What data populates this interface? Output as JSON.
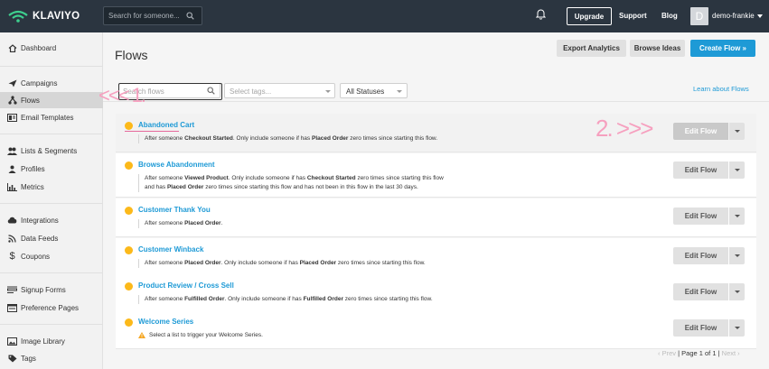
{
  "brand": {
    "name": "KLAVIYO",
    "accent": "#1e9ad6",
    "dot_color": "#fcb91a",
    "annotation_color": "#f6a0bf"
  },
  "topbar": {
    "search_placeholder": "Search for someone...",
    "upgrade": "Upgrade",
    "support": "Support",
    "blog": "Blog",
    "avatar_letter": "D",
    "user": "demo-frankie"
  },
  "sidebar": {
    "items": [
      {
        "label": "Dashboard",
        "icon": "home-icon"
      },
      {
        "label": "Campaigns",
        "icon": "paper-plane-icon"
      },
      {
        "label": "Flows",
        "icon": "flows-icon",
        "active": true
      },
      {
        "label": "Email Templates",
        "icon": "template-icon"
      },
      {
        "label": "Lists & Segments",
        "icon": "users-icon"
      },
      {
        "label": "Profiles",
        "icon": "person-icon"
      },
      {
        "label": "Metrics",
        "icon": "bar-chart-icon"
      },
      {
        "label": "Integrations",
        "icon": "cloud-icon"
      },
      {
        "label": "Data Feeds",
        "icon": "rss-icon"
      },
      {
        "label": "Coupons",
        "icon": "dollar-icon"
      },
      {
        "label": "Signup Forms",
        "icon": "form-icon"
      },
      {
        "label": "Preference Pages",
        "icon": "page-icon"
      },
      {
        "label": "Image Library",
        "icon": "image-icon"
      },
      {
        "label": "Tags",
        "icon": "tag-icon"
      }
    ]
  },
  "main": {
    "title": "Flows",
    "export": "Export Analytics",
    "browse": "Browse Ideas",
    "create": "Create Flow »",
    "learn": "Learn about Flows",
    "filter_search_placeholder": "Search flows",
    "filter_tags_placeholder": "Select tags...",
    "filter_status": "All Statuses",
    "edit_label": "Edit Flow",
    "flows": [
      {
        "name": "Abandoned Cart",
        "desc_html": "After someone <b>Checkout Started</b>. Only include someone if has <b>Placed Order</b> zero times since starting this flow."
      },
      {
        "name": "Browse Abandonment",
        "desc_html": "After someone <b>Viewed Product</b>. Only include someone if has <b>Checkout Started</b> zero times since starting this flow<br>and has <b>Placed Order</b> zero times since starting this flow and has not been in this flow in the last 30 days."
      },
      {
        "name": "Customer Thank You",
        "desc_html": "After someone <b>Placed Order</b>."
      },
      {
        "name": "Customer Winback",
        "desc_html": "After someone <b>Placed Order</b>. Only include someone if has <b>Placed Order</b> zero times since starting this flow."
      },
      {
        "name": "Product Review / Cross Sell",
        "desc_html": "After someone <b>Fulfilled Order</b>. Only include someone if has <b>Fulfilled Order</b> zero times since starting this flow."
      },
      {
        "name": "Welcome Series",
        "desc_html": "Select a list to trigger your Welcome Series.",
        "warning": true
      }
    ],
    "pager": {
      "prev": "‹ Prev",
      "label": "Page 1 of 1",
      "next": "Next ›",
      "sep": "|"
    }
  },
  "annotations": {
    "one": "<<< 1.",
    "two": "2. >>>"
  }
}
